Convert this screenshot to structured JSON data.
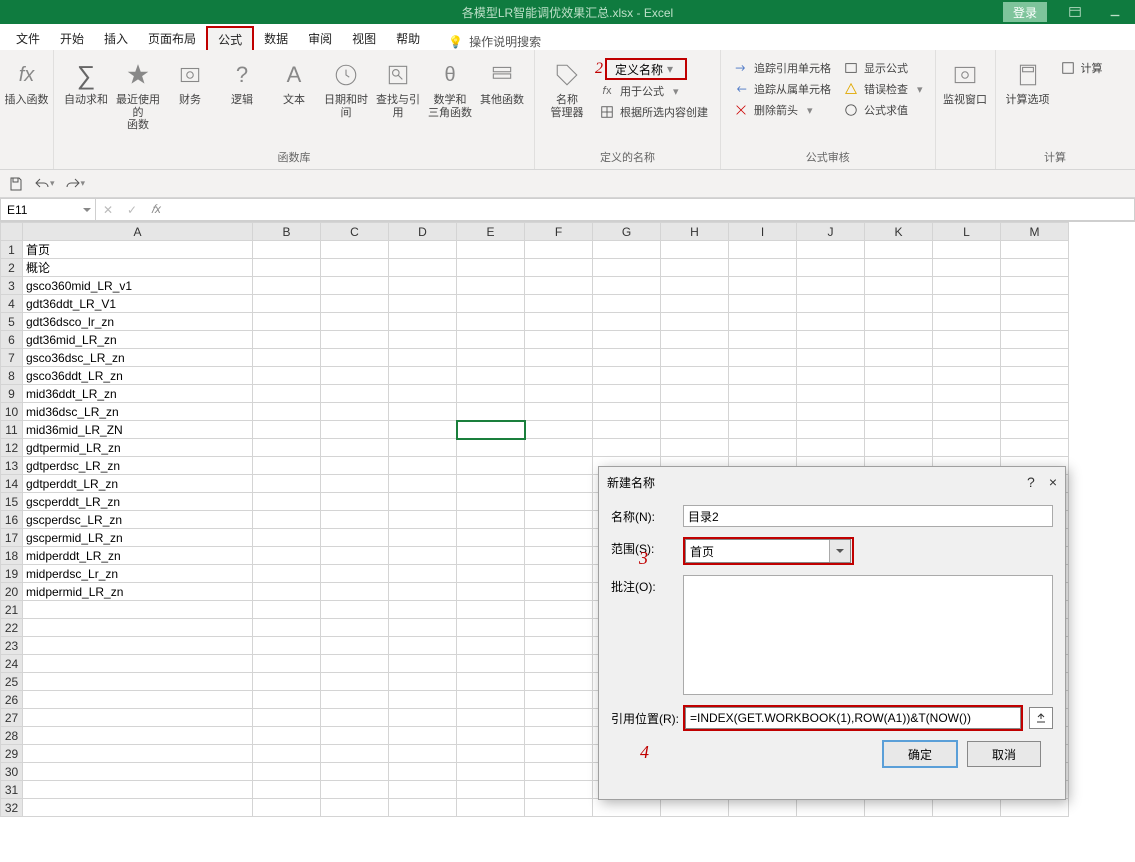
{
  "window": {
    "title": "各模型LR智能调优效果汇总.xlsx - Excel",
    "login_btn": "登录"
  },
  "menu": {
    "tabs": [
      "文件",
      "开始",
      "插入",
      "页面布局",
      "公式",
      "数据",
      "审阅",
      "视图",
      "帮助"
    ],
    "active_index": 4,
    "tell_me": "操作说明搜索"
  },
  "ribbon": {
    "groups": {
      "insert_fn": {
        "label": "插入函数",
        "btn_insert_fn": "插入函数"
      },
      "fn_lib": {
        "label": "函数库",
        "autosum": "自动求和",
        "recent": "最近使用的\n函数",
        "financial": "财务",
        "logical": "逻辑",
        "text": "文本",
        "datetime": "日期和时间",
        "lookup": "查找与引用",
        "mathtrig": "数学和\n三角函数",
        "more": "其他函数"
      },
      "defined": {
        "label": "定义的名称",
        "manager": "名称\n管理器",
        "define": "定义名称",
        "use": "用于公式",
        "create": "根据所选内容创建"
      },
      "audit": {
        "label": "公式审核",
        "trace_prec": "追踪引用单元格",
        "trace_dep": "追踪从属单元格",
        "remove_arrows": "删除箭头",
        "show_fmla": "显示公式",
        "error_check": "错误检查",
        "eval": "公式求值"
      },
      "watch": {
        "label": "",
        "btn": "监视窗口"
      },
      "calc": {
        "label": "计算",
        "options": "计算选项",
        "calc_now": "计算"
      }
    }
  },
  "qat": {},
  "fbar": {
    "namebox": "E11",
    "formula": ""
  },
  "grid": {
    "columns": [
      "A",
      "B",
      "C",
      "D",
      "E",
      "F",
      "G",
      "H",
      "I",
      "J",
      "K",
      "L",
      "M"
    ],
    "rows": [
      {
        "n": 1,
        "A": "首页"
      },
      {
        "n": 2,
        "A": "概论"
      },
      {
        "n": 3,
        "A": "gsco360mid_LR_v1"
      },
      {
        "n": 4,
        "A": "gdt36ddt_LR_V1"
      },
      {
        "n": 5,
        "A": "gdt36dsco_lr_zn"
      },
      {
        "n": 6,
        "A": "gdt36mid_LR_zn"
      },
      {
        "n": 7,
        "A": "gsco36dsc_LR_zn"
      },
      {
        "n": 8,
        "A": "gsco36ddt_LR_zn"
      },
      {
        "n": 9,
        "A": "mid36ddt_LR_zn"
      },
      {
        "n": 10,
        "A": "mid36dsc_LR_zn"
      },
      {
        "n": 11,
        "A": "mid36mid_LR_ZN"
      },
      {
        "n": 12,
        "A": "gdtpermid_LR_zn"
      },
      {
        "n": 13,
        "A": "gdtperdsc_LR_zn"
      },
      {
        "n": 14,
        "A": "gdtperddt_LR_zn"
      },
      {
        "n": 15,
        "A": "gscperddt_LR_zn"
      },
      {
        "n": 16,
        "A": "gscperdsc_LR_zn"
      },
      {
        "n": 17,
        "A": "gscpermid_LR_zn"
      },
      {
        "n": 18,
        "A": "midperddt_LR_zn"
      },
      {
        "n": 19,
        "A": "midperdsc_Lr_zn"
      },
      {
        "n": 20,
        "A": "midpermid_LR_zn"
      },
      {
        "n": 21,
        "A": ""
      },
      {
        "n": 22,
        "A": ""
      },
      {
        "n": 23,
        "A": ""
      },
      {
        "n": 24,
        "A": ""
      },
      {
        "n": 25,
        "A": ""
      },
      {
        "n": 26,
        "A": ""
      },
      {
        "n": 27,
        "A": ""
      },
      {
        "n": 28,
        "A": ""
      },
      {
        "n": 29,
        "A": ""
      },
      {
        "n": 30,
        "A": ""
      },
      {
        "n": 31,
        "A": ""
      },
      {
        "n": 32,
        "A": ""
      }
    ],
    "selected": "E11"
  },
  "dialog": {
    "title": "新建名称",
    "name_label": "名称(N):",
    "name_value": "目录2",
    "scope_label": "范围(S):",
    "scope_value": "首页",
    "comment_label": "批注(O):",
    "comment_value": "",
    "refers_label": "引用位置(R):",
    "refers_value": "=INDEX(GET.WORKBOOK(1),ROW(A1))&T(NOW())",
    "ok": "确定",
    "cancel": "取消",
    "help": "?",
    "close": "×"
  },
  "callouts": {
    "c2": "2",
    "c3": "3",
    "c4": "4"
  }
}
